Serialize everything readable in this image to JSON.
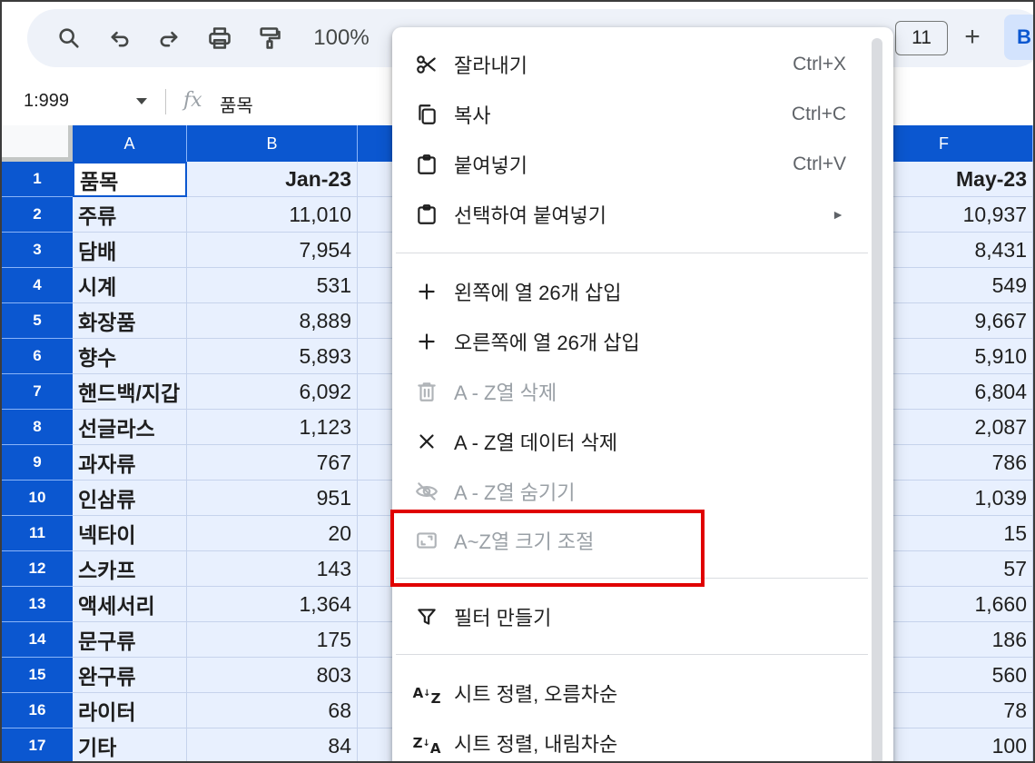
{
  "toolbar": {
    "zoom": "100%",
    "font_size": "11",
    "bold_label": "B",
    "plus_label": "+"
  },
  "formula_bar": {
    "name_box": "1:999",
    "fx": "fx",
    "content": "품목"
  },
  "columns": [
    "A",
    "B",
    "F"
  ],
  "sheet": {
    "rows": [
      {
        "num": "1",
        "a": "품목",
        "b": "Jan-23",
        "f": "May-23"
      },
      {
        "num": "2",
        "a": "주류",
        "b": "11,010",
        "f": "10,937"
      },
      {
        "num": "3",
        "a": "담배",
        "b": "7,954",
        "f": "8,431"
      },
      {
        "num": "4",
        "a": "시계",
        "b": "531",
        "f": "549"
      },
      {
        "num": "5",
        "a": "화장품",
        "b": "8,889",
        "f": "9,667"
      },
      {
        "num": "6",
        "a": "향수",
        "b": "5,893",
        "f": "5,910"
      },
      {
        "num": "7",
        "a": "핸드백/지갑",
        "b": "6,092",
        "f": "6,804"
      },
      {
        "num": "8",
        "a": "선글라스",
        "b": "1,123",
        "f": "2,087"
      },
      {
        "num": "9",
        "a": "과자류",
        "b": "767",
        "f": "786"
      },
      {
        "num": "10",
        "a": "인삼류",
        "b": "951",
        "f": "1,039"
      },
      {
        "num": "11",
        "a": "넥타이",
        "b": "20",
        "f": "15"
      },
      {
        "num": "12",
        "a": "스카프",
        "b": "143",
        "f": "57"
      },
      {
        "num": "13",
        "a": "액세서리",
        "b": "1,364",
        "f": "1,660"
      },
      {
        "num": "14",
        "a": "문구류",
        "b": "175",
        "f": "186"
      },
      {
        "num": "15",
        "a": "완구류",
        "b": "803",
        "f": "560"
      },
      {
        "num": "16",
        "a": "라이터",
        "b": "68",
        "f": "78"
      },
      {
        "num": "17",
        "a": "기타",
        "b": "84",
        "f": "100"
      }
    ]
  },
  "menu": {
    "cut": {
      "label": "잘라내기",
      "shortcut": "Ctrl+X"
    },
    "copy": {
      "label": "복사",
      "shortcut": "Ctrl+C"
    },
    "paste": {
      "label": "붙여넣기",
      "shortcut": "Ctrl+V"
    },
    "paste_special": {
      "label": "선택하여 붙여넣기",
      "arrow": "►"
    },
    "insert_left": {
      "label": "왼쪽에 열 26개 삽입"
    },
    "insert_right": {
      "label": "오른쪽에 열 26개 삽입"
    },
    "delete_cols": {
      "label": "A - Z열 삭제"
    },
    "clear_cols": {
      "label": "A - Z열 데이터 삭제"
    },
    "hide_cols": {
      "label": "A - Z열 숨기기"
    },
    "resize_cols": {
      "label": "A~Z열 크기 조절"
    },
    "create_filter": {
      "label": "필터 만들기"
    },
    "sort_asc": {
      "label": "시트 정렬, 오름차순"
    },
    "sort_desc": {
      "label": "시트 정렬, 내림차순"
    }
  },
  "colors": {
    "header_blue": "#0b57d0",
    "selection_fill": "#e8f0fe",
    "highlight_red": "#e00000"
  }
}
